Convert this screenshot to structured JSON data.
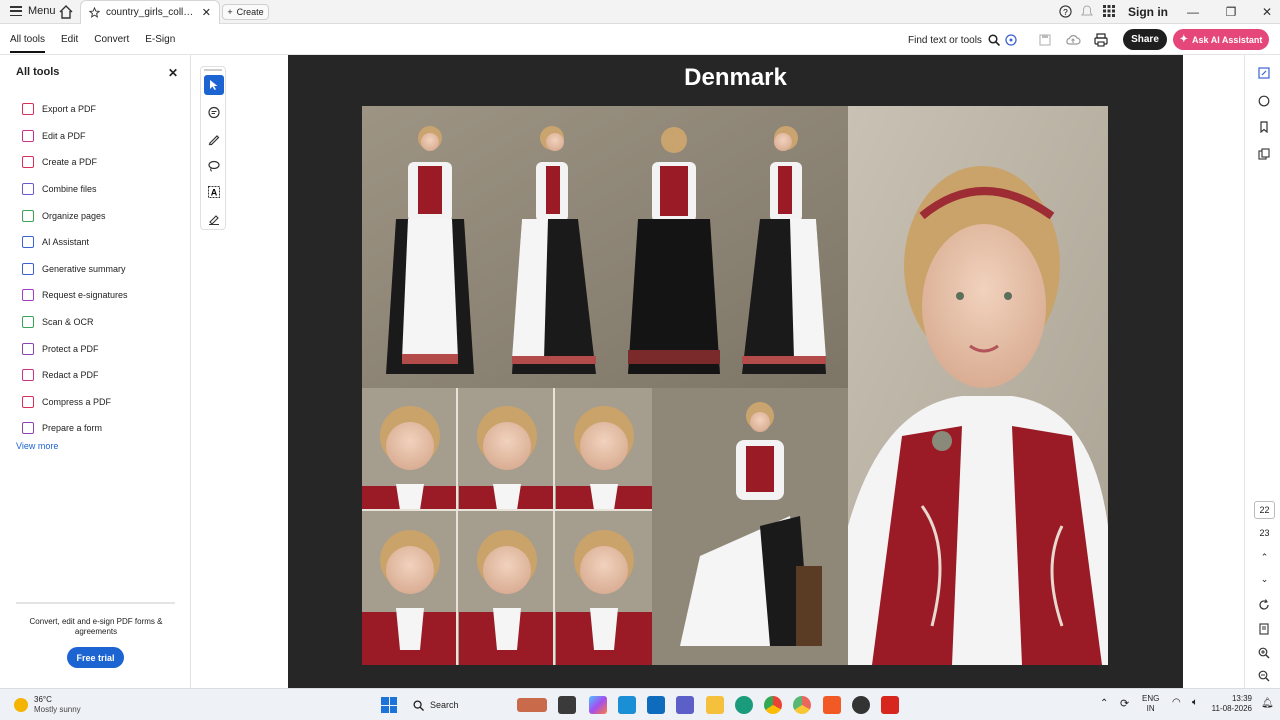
{
  "titlebar": {
    "menu_label": "Menu",
    "tab_title": "country_girls_collection...",
    "create_label": "Create",
    "signin_label": "Sign in"
  },
  "toolbar": {
    "tabs": [
      "All tools",
      "Edit",
      "Convert",
      "E-Sign"
    ],
    "find_label": "Find text or tools",
    "share_label": "Share",
    "ask_label": "Ask AI Assistant"
  },
  "left_panel": {
    "title": "All tools",
    "items": [
      {
        "label": "Export a PDF",
        "color": "#d6315b"
      },
      {
        "label": "Edit a PDF",
        "color": "#c7358a"
      },
      {
        "label": "Create a PDF",
        "color": "#d6315b"
      },
      {
        "label": "Combine files",
        "color": "#6a5acd"
      },
      {
        "label": "Organize pages",
        "color": "#3aa45b"
      },
      {
        "label": "AI Assistant",
        "color": "#3c63d2"
      },
      {
        "label": "Generative summary",
        "color": "#3c63d2"
      },
      {
        "label": "Request e-signatures",
        "color": "#a03ec4"
      },
      {
        "label": "Scan & OCR",
        "color": "#3aa45b"
      },
      {
        "label": "Protect a PDF",
        "color": "#8e44ad"
      },
      {
        "label": "Redact a PDF",
        "color": "#c7358a"
      },
      {
        "label": "Compress a PDF",
        "color": "#d6315b"
      },
      {
        "label": "Prepare a form",
        "color": "#8e44ad"
      }
    ],
    "view_more": "View more",
    "promo": "Convert, edit and e-sign PDF forms & agreements",
    "free_trial": "Free trial"
  },
  "document": {
    "page_title": "Denmark"
  },
  "right_rail": {
    "page_current": "22",
    "page_next": "23"
  },
  "taskbar": {
    "temp": "36°C",
    "weather": "Mostly sunny",
    "search": "Search",
    "lang1": "ENG",
    "lang2": "IN",
    "time": "13:39",
    "date": "11-08-2026"
  }
}
